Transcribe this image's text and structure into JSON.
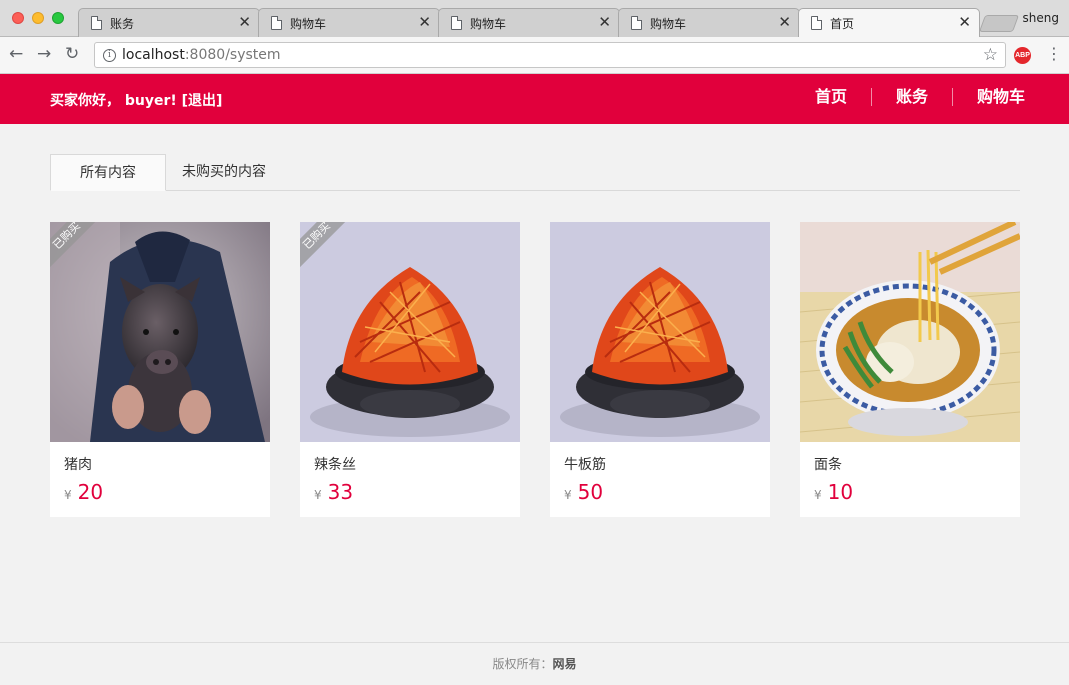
{
  "browser": {
    "tabs": [
      {
        "title": "账务"
      },
      {
        "title": "购物车"
      },
      {
        "title": "购物车"
      },
      {
        "title": "购物车"
      },
      {
        "title": "首页"
      }
    ],
    "close_glyph": "✕",
    "profile_name": "sheng",
    "url_host": "localhost",
    "url_path": ":8080/system",
    "abp_label": "ABP"
  },
  "header": {
    "greeting": "买家你好， buyer!",
    "logout": "[退出]",
    "nav": [
      {
        "label": "首页"
      },
      {
        "label": "账务"
      },
      {
        "label": "购物车"
      }
    ],
    "color": "#e1003c"
  },
  "content_tabs": [
    {
      "label": "所有内容"
    },
    {
      "label": "未购买的内容"
    }
  ],
  "products": [
    {
      "name": "猪肉",
      "currency": "¥",
      "price": "20",
      "badge": "已购买",
      "image": "pig-photo-icon"
    },
    {
      "name": "辣条丝",
      "currency": "¥",
      "price": "33",
      "badge": "已购买",
      "image": "spicy-strips-photo-icon"
    },
    {
      "name": "牛板筋",
      "currency": "¥",
      "price": "50",
      "badge": "",
      "image": "spicy-strips-photo-icon"
    },
    {
      "name": "面条",
      "currency": "¥",
      "price": "10",
      "badge": "",
      "image": "noodle-bowl-photo-icon"
    }
  ],
  "footer": {
    "label": "版权所有：",
    "company": "网易"
  }
}
